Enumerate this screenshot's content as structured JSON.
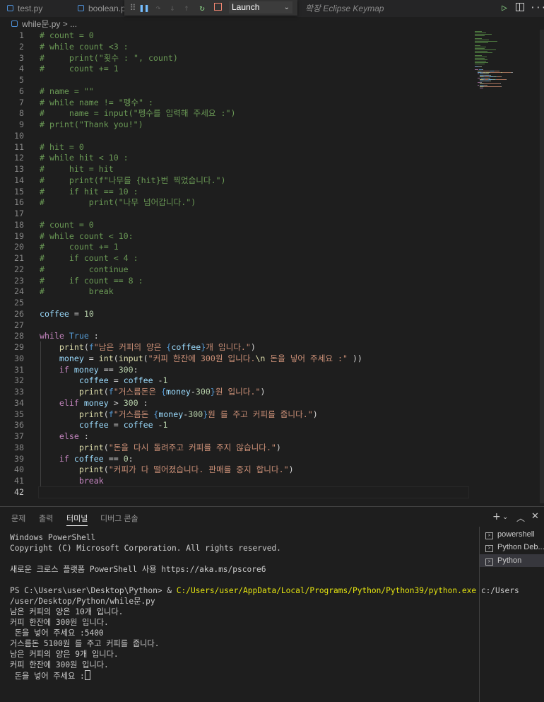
{
  "tabs": [
    {
      "label": "test.py"
    },
    {
      "label": "boolean.p"
    }
  ],
  "debug": {
    "config": "Launch"
  },
  "keymap_hint": "확장 Eclipse Keymap",
  "breadcrumb": {
    "file": "while문.py",
    "sep": ">",
    "rest": "..."
  },
  "editor": {
    "lines": [
      {
        "num": "1",
        "tokens": [
          {
            "t": "# count = 0",
            "c": "c"
          }
        ]
      },
      {
        "num": "2",
        "tokens": [
          {
            "t": "# while count <3 :",
            "c": "c"
          }
        ]
      },
      {
        "num": "3",
        "tokens": [
          {
            "t": "#     print(\"횟수 : \", count)",
            "c": "c"
          }
        ]
      },
      {
        "num": "4",
        "tokens": [
          {
            "t": "#     count += 1",
            "c": "c"
          }
        ]
      },
      {
        "num": "5",
        "tokens": []
      },
      {
        "num": "6",
        "tokens": [
          {
            "t": "# name = \"\"",
            "c": "c"
          }
        ]
      },
      {
        "num": "7",
        "tokens": [
          {
            "t": "# while name != \"펭수\" :",
            "c": "c"
          }
        ]
      },
      {
        "num": "8",
        "tokens": [
          {
            "t": "#     name = input(\"펭수를 입력해 주세요 :\")",
            "c": "c"
          }
        ]
      },
      {
        "num": "9",
        "tokens": [
          {
            "t": "# print(\"Thank you!\")",
            "c": "c"
          }
        ]
      },
      {
        "num": "10",
        "tokens": []
      },
      {
        "num": "11",
        "tokens": [
          {
            "t": "# hit = 0",
            "c": "c"
          }
        ]
      },
      {
        "num": "12",
        "tokens": [
          {
            "t": "# while hit < 10 :",
            "c": "c"
          }
        ]
      },
      {
        "num": "13",
        "tokens": [
          {
            "t": "#     hit = hit",
            "c": "c"
          }
        ]
      },
      {
        "num": "14",
        "tokens": [
          {
            "t": "#     print(f\"나무를 {hit}번 찍었습니다.\")",
            "c": "c"
          }
        ]
      },
      {
        "num": "15",
        "tokens": [
          {
            "t": "#     if hit == 10 :",
            "c": "c"
          }
        ]
      },
      {
        "num": "16",
        "tokens": [
          {
            "t": "#         print(\"나무 넘어갑니다.\")",
            "c": "c"
          }
        ]
      },
      {
        "num": "17",
        "tokens": []
      },
      {
        "num": "18",
        "tokens": [
          {
            "t": "# count = 0",
            "c": "c"
          }
        ]
      },
      {
        "num": "19",
        "tokens": [
          {
            "t": "# while count < 10:",
            "c": "c"
          }
        ]
      },
      {
        "num": "20",
        "tokens": [
          {
            "t": "#     count += 1",
            "c": "c"
          }
        ]
      },
      {
        "num": "21",
        "tokens": [
          {
            "t": "#     if count < 4 :",
            "c": "c"
          }
        ]
      },
      {
        "num": "22",
        "tokens": [
          {
            "t": "#         continue",
            "c": "c"
          }
        ]
      },
      {
        "num": "23",
        "tokens": [
          {
            "t": "#     if count == 8 :",
            "c": "c"
          }
        ]
      },
      {
        "num": "24",
        "tokens": [
          {
            "t": "#         break",
            "c": "c"
          }
        ]
      },
      {
        "num": "25",
        "tokens": []
      },
      {
        "num": "26",
        "tokens": [
          {
            "t": "coffee",
            "c": "v"
          },
          {
            "t": " = ",
            "c": "t"
          },
          {
            "t": "10",
            "c": "n"
          }
        ]
      },
      {
        "num": "27",
        "tokens": []
      },
      {
        "num": "28",
        "tokens": [
          {
            "t": "while",
            "c": "k"
          },
          {
            "t": " ",
            "c": "t"
          },
          {
            "t": "True",
            "c": "b"
          },
          {
            "t": " :",
            "c": "t"
          }
        ]
      },
      {
        "num": "29",
        "tokens": [
          {
            "t": "    ",
            "c": "t"
          },
          {
            "t": "print",
            "c": "f"
          },
          {
            "t": "(",
            "c": "t"
          },
          {
            "t": "f",
            "c": "b"
          },
          {
            "t": "\"남은 커피의 양은 ",
            "c": "s"
          },
          {
            "t": "{",
            "c": "b"
          },
          {
            "t": "coffee",
            "c": "v"
          },
          {
            "t": "}",
            "c": "b"
          },
          {
            "t": "개 입니다.\"",
            "c": "s"
          },
          {
            "t": ")",
            "c": "t"
          }
        ]
      },
      {
        "num": "30",
        "tokens": [
          {
            "t": "    ",
            "c": "t"
          },
          {
            "t": "money",
            "c": "v"
          },
          {
            "t": " = ",
            "c": "t"
          },
          {
            "t": "int",
            "c": "f"
          },
          {
            "t": "(",
            "c": "t"
          },
          {
            "t": "input",
            "c": "f"
          },
          {
            "t": "(",
            "c": "t"
          },
          {
            "t": "\"커피 한잔에 300원 입니다.",
            "c": "s"
          },
          {
            "t": "\\n",
            "c": "f"
          },
          {
            "t": " 돈을 넣어 주세요 :\"",
            "c": "s"
          },
          {
            "t": " ))",
            "c": "t"
          }
        ]
      },
      {
        "num": "31",
        "tokens": [
          {
            "t": "    ",
            "c": "t"
          },
          {
            "t": "if",
            "c": "k"
          },
          {
            "t": " ",
            "c": "t"
          },
          {
            "t": "money",
            "c": "v"
          },
          {
            "t": " == ",
            "c": "t"
          },
          {
            "t": "300",
            "c": "n"
          },
          {
            "t": ":",
            "c": "t"
          }
        ]
      },
      {
        "num": "32",
        "tokens": [
          {
            "t": "        ",
            "c": "t"
          },
          {
            "t": "coffee",
            "c": "v"
          },
          {
            "t": " = ",
            "c": "t"
          },
          {
            "t": "coffee",
            "c": "v"
          },
          {
            "t": " -",
            "c": "t"
          },
          {
            "t": "1",
            "c": "n"
          }
        ]
      },
      {
        "num": "33",
        "tokens": [
          {
            "t": "        ",
            "c": "t"
          },
          {
            "t": "print",
            "c": "f"
          },
          {
            "t": "(",
            "c": "t"
          },
          {
            "t": "f",
            "c": "b"
          },
          {
            "t": "\"거스름돈은 ",
            "c": "s"
          },
          {
            "t": "{",
            "c": "b"
          },
          {
            "t": "money",
            "c": "v"
          },
          {
            "t": "-",
            "c": "t"
          },
          {
            "t": "300",
            "c": "n"
          },
          {
            "t": "}",
            "c": "b"
          },
          {
            "t": "원 입니다.\"",
            "c": "s"
          },
          {
            "t": ")",
            "c": "t"
          }
        ]
      },
      {
        "num": "34",
        "tokens": [
          {
            "t": "    ",
            "c": "t"
          },
          {
            "t": "elif",
            "c": "k"
          },
          {
            "t": " ",
            "c": "t"
          },
          {
            "t": "money",
            "c": "v"
          },
          {
            "t": " > ",
            "c": "t"
          },
          {
            "t": "300",
            "c": "n"
          },
          {
            "t": " :",
            "c": "t"
          }
        ]
      },
      {
        "num": "35",
        "tokens": [
          {
            "t": "        ",
            "c": "t"
          },
          {
            "t": "print",
            "c": "f"
          },
          {
            "t": "(",
            "c": "t"
          },
          {
            "t": "f",
            "c": "b"
          },
          {
            "t": "\"거스름돈 ",
            "c": "s"
          },
          {
            "t": "{",
            "c": "b"
          },
          {
            "t": "money",
            "c": "v"
          },
          {
            "t": "-",
            "c": "t"
          },
          {
            "t": "300",
            "c": "n"
          },
          {
            "t": "}",
            "c": "b"
          },
          {
            "t": "원 를 주고 커피를 줍니다.\"",
            "c": "s"
          },
          {
            "t": ")",
            "c": "t"
          }
        ]
      },
      {
        "num": "36",
        "tokens": [
          {
            "t": "        ",
            "c": "t"
          },
          {
            "t": "coffee",
            "c": "v"
          },
          {
            "t": " = ",
            "c": "t"
          },
          {
            "t": "coffee",
            "c": "v"
          },
          {
            "t": " -",
            "c": "t"
          },
          {
            "t": "1",
            "c": "n"
          }
        ]
      },
      {
        "num": "37",
        "tokens": [
          {
            "t": "    ",
            "c": "t"
          },
          {
            "t": "else",
            "c": "k"
          },
          {
            "t": " :",
            "c": "t"
          }
        ]
      },
      {
        "num": "38",
        "tokens": [
          {
            "t": "        ",
            "c": "t"
          },
          {
            "t": "print",
            "c": "f"
          },
          {
            "t": "(",
            "c": "t"
          },
          {
            "t": "\"돈을 다시 돌려주고 커피를 주지 않습니다.\"",
            "c": "s"
          },
          {
            "t": ")",
            "c": "t"
          }
        ]
      },
      {
        "num": "39",
        "tokens": [
          {
            "t": "    ",
            "c": "t"
          },
          {
            "t": "if",
            "c": "k"
          },
          {
            "t": " ",
            "c": "t"
          },
          {
            "t": "coffee",
            "c": "v"
          },
          {
            "t": " == ",
            "c": "t"
          },
          {
            "t": "0",
            "c": "n"
          },
          {
            "t": ":",
            "c": "t"
          }
        ]
      },
      {
        "num": "40",
        "tokens": [
          {
            "t": "        ",
            "c": "t"
          },
          {
            "t": "print",
            "c": "f"
          },
          {
            "t": "(",
            "c": "t"
          },
          {
            "t": "\"커피가 다 떨어졌습니다. 판매를 중지 합니다.\"",
            "c": "s"
          },
          {
            "t": ")",
            "c": "t"
          }
        ]
      },
      {
        "num": "41",
        "tokens": [
          {
            "t": "        ",
            "c": "t"
          },
          {
            "t": "break",
            "c": "k"
          }
        ]
      },
      {
        "num": "42",
        "tokens": []
      }
    ]
  },
  "panel": {
    "tabs": [
      "문제",
      "출력",
      "터미널",
      "디버그 콘솔"
    ],
    "active_tab": "터미널",
    "terminal_lines": [
      {
        "t": "Windows PowerShell"
      },
      {
        "t": "Copyright (C) Microsoft Corporation. All rights reserved."
      },
      {
        "t": ""
      },
      {
        "t": "새로운 크로스 플랫폼 PowerShell 사용 https://aka.ms/pscore6"
      },
      {
        "t": ""
      },
      {
        "t": "PS C:\\Users\\user\\Desktop\\Python> & ",
        "y": "C:/Users/user/AppData/Local/Programs/Python/Python39/python.exe",
        "r": " c:/Users"
      },
      {
        "t": "/user/Desktop/Python/while문.py"
      },
      {
        "t": "남은 커피의 양은 10개 입니다."
      },
      {
        "t": "커피 한잔에 300원 입니다."
      },
      {
        "t": " 돈을 넣어 주세요 :5400"
      },
      {
        "t": "거스름돈 5100원 를 주고 커피를 줍니다."
      },
      {
        "t": "남은 커피의 양은 9개 입니다."
      },
      {
        "t": "커피 한잔에 300원 입니다."
      },
      {
        "t": " 돈을 넣어 주세요 :",
        "cursor": true
      }
    ],
    "terminals": [
      "powershell",
      "Python Deb...",
      "Python"
    ],
    "selected_terminal": "Python"
  }
}
